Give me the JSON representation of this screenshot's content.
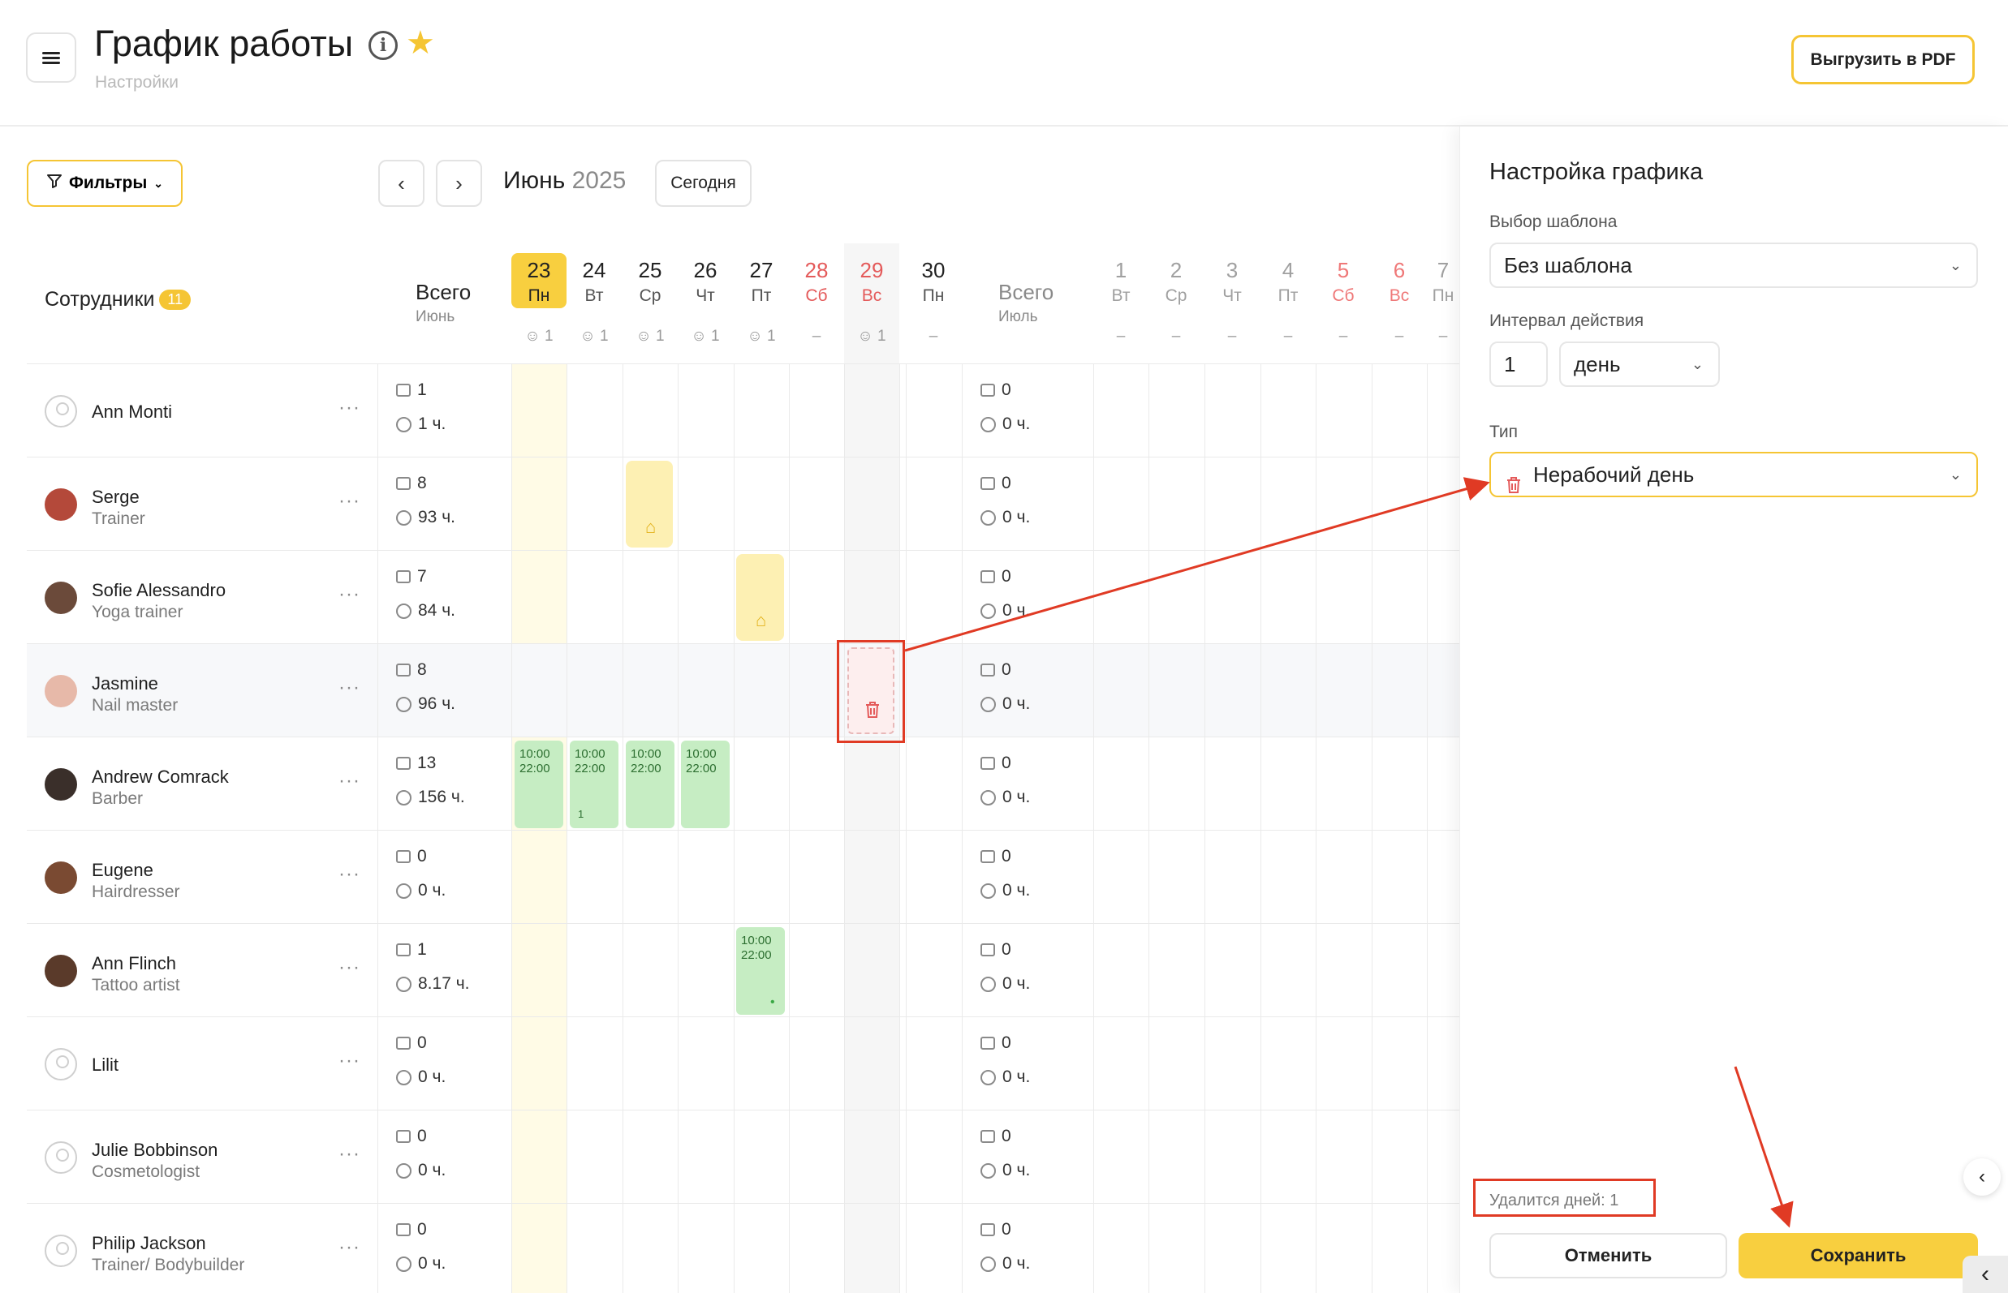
{
  "header": {
    "title": "График работы",
    "subtitle": "Настройки",
    "pdf_button": "Выгрузить в PDF"
  },
  "toolbar": {
    "filters": "Фильтры",
    "month": "Июнь",
    "year": "2025",
    "today": "Сегодня"
  },
  "employees_header": {
    "label": "Сотрудники",
    "count": "11"
  },
  "totals": [
    {
      "title": "Всего",
      "month": "Июнь"
    },
    {
      "title": "Всего",
      "month": "Июль"
    }
  ],
  "days_june": [
    {
      "num": "23",
      "wd": "Пн",
      "count": "1",
      "today": true
    },
    {
      "num": "24",
      "wd": "Вт",
      "count": "1"
    },
    {
      "num": "25",
      "wd": "Ср",
      "count": "1"
    },
    {
      "num": "26",
      "wd": "Чт",
      "count": "1"
    },
    {
      "num": "27",
      "wd": "Пт",
      "count": "1"
    },
    {
      "num": "28",
      "wd": "Сб",
      "count": "–",
      "weekend": true
    },
    {
      "num": "29",
      "wd": "Вс",
      "count": "1",
      "weekend": true
    },
    {
      "num": "30",
      "wd": "Пн",
      "count": "–"
    }
  ],
  "days_july": [
    {
      "num": "1",
      "wd": "Вт",
      "count": "–"
    },
    {
      "num": "2",
      "wd": "Ср",
      "count": "–"
    },
    {
      "num": "3",
      "wd": "Чт",
      "count": "–"
    },
    {
      "num": "4",
      "wd": "Пт",
      "count": "–"
    },
    {
      "num": "5",
      "wd": "Сб",
      "count": "–",
      "weekend": true
    },
    {
      "num": "6",
      "wd": "Вс",
      "count": "–",
      "weekend": true
    },
    {
      "num": "7",
      "wd": "Пн",
      "count": "–"
    }
  ],
  "employees": [
    {
      "name": "Ann Monti",
      "role": "",
      "shifts": "1",
      "hours": "1 ч.",
      "july_shifts": "0",
      "july_hours": "0 ч.",
      "avatar": "placeholder"
    },
    {
      "name": "Serge",
      "role": "Trainer",
      "shifts": "8",
      "hours": "93 ч.",
      "july_shifts": "0",
      "july_hours": "0 ч.",
      "avatar": "photo",
      "color": "#b4493a"
    },
    {
      "name": "Sofie Alessandro",
      "role": "Yoga trainer",
      "shifts": "7",
      "hours": "84 ч.",
      "july_shifts": "0",
      "july_hours": "0 ч.",
      "avatar": "photo",
      "color": "#6b4a3a"
    },
    {
      "name": "Jasmine",
      "role": "Nail master",
      "shifts": "8",
      "hours": "96 ч.",
      "july_shifts": "0",
      "july_hours": "0 ч.",
      "avatar": "photo",
      "color": "#e7b9a9"
    },
    {
      "name": "Andrew Comrack",
      "role": "Barber",
      "shifts": "13",
      "hours": "156 ч.",
      "july_shifts": "0",
      "july_hours": "0 ч.",
      "avatar": "photo",
      "color": "#3a2f2a"
    },
    {
      "name": "Eugene",
      "role": "Hairdresser",
      "shifts": "0",
      "hours": "0 ч.",
      "july_shifts": "0",
      "july_hours": "0 ч.",
      "avatar": "photo",
      "color": "#7a4a32"
    },
    {
      "name": "Ann Flinch",
      "role": "Tattoo artist",
      "shifts": "1",
      "hours": "8.17 ч.",
      "july_shifts": "0",
      "july_hours": "0 ч.",
      "avatar": "photo",
      "color": "#5a3a2a"
    },
    {
      "name": "Lilit",
      "role": "",
      "shifts": "0",
      "hours": "0 ч.",
      "july_shifts": "0",
      "july_hours": "0 ч.",
      "avatar": "placeholder"
    },
    {
      "name": "Julie Bobbinson",
      "role": "Cosmetologist",
      "shifts": "0",
      "hours": "0 ч.",
      "july_shifts": "0",
      "july_hours": "0 ч.",
      "avatar": "placeholder"
    },
    {
      "name": "Philip Jackson",
      "role": "Trainer/ Bodybuilder",
      "shifts": "0",
      "hours": "0 ч.",
      "july_shifts": "0",
      "july_hours": "0 ч.",
      "avatar": "placeholder"
    }
  ],
  "shift_cells": [
    {
      "start": "10:00",
      "end": "22:00",
      "note": ""
    },
    {
      "start": "10:00",
      "end": "22:00",
      "note": "1"
    },
    {
      "start": "10:00",
      "end": "22:00",
      "note": ""
    },
    {
      "start": "10:00",
      "end": "22:00",
      "note": ""
    },
    {
      "start": "10:00",
      "end": "22:00",
      "note": "•"
    }
  ],
  "panel": {
    "title": "Настройка графика",
    "template_label": "Выбор шаблона",
    "template_value": "Без шаблона",
    "interval_label": "Интервал действия",
    "interval_value": "1",
    "interval_unit": "день",
    "type_label": "Тип",
    "type_value": "Нерабочий день",
    "delete_info": "Удалится дней: 1",
    "cancel": "Отменить",
    "save": "Сохранить"
  },
  "colors": {
    "accent": "#f5c534",
    "shift": "#c6edc3",
    "annotation": "#e03a24",
    "weekend": "#e45a5a"
  },
  "icons": [
    "menu-icon",
    "info-icon",
    "star-icon",
    "filter-icon",
    "chevron-left-icon",
    "chevron-right-icon",
    "user-icon",
    "briefcase-icon",
    "clock-icon",
    "home-icon",
    "trash-icon",
    "chevron-down-icon"
  ]
}
